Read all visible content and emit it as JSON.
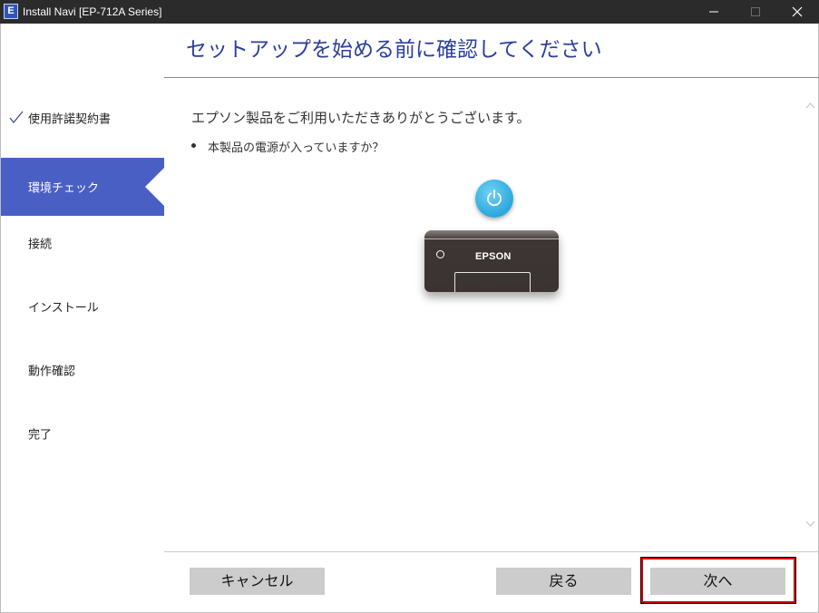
{
  "window": {
    "app_icon_letter": "E",
    "title": "Install Navi [EP-712A Series]"
  },
  "header": {
    "title": "セットアップを始める前に確認してください"
  },
  "sidebar": {
    "steps": [
      {
        "label": "使用許諾契約書",
        "status": "completed"
      },
      {
        "label": "環境チェック",
        "status": "active"
      },
      {
        "label": "接続",
        "status": "pending"
      },
      {
        "label": "インストール",
        "status": "pending"
      },
      {
        "label": "動作確認",
        "status": "pending"
      },
      {
        "label": "完了",
        "status": "pending"
      }
    ]
  },
  "main": {
    "greeting": "エプソン製品をご利用いただきありがとうございます。",
    "bullets": [
      "本製品の電源が入っていますか？"
    ],
    "illustration": {
      "power_icon": "power-icon",
      "printer_brand": "EPSON"
    }
  },
  "footer": {
    "cancel_label": "キャンセル",
    "back_label": "戻る",
    "next_label": "次へ"
  },
  "colors": {
    "titlebar_bg": "#2b2b2b",
    "active_step_bg": "#4a5fc4",
    "title_text": "#2b3f9e",
    "button_bg": "#cccccc",
    "highlight_border": "#d40000",
    "power_button": "#2ba8de"
  }
}
